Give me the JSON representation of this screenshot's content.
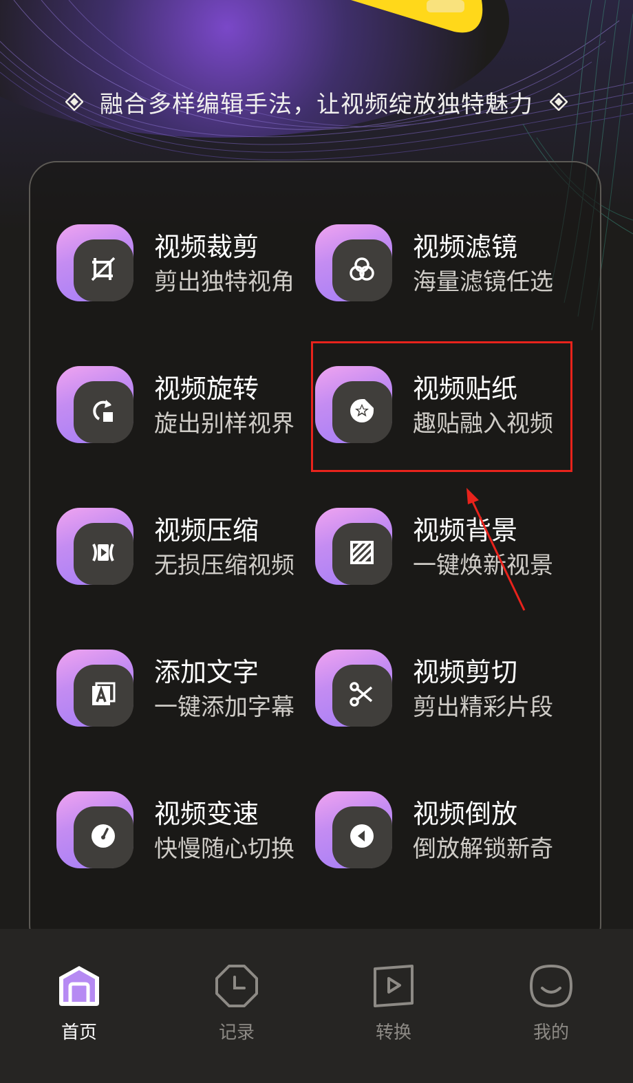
{
  "colors": {
    "background": "#1d1c1a",
    "accent_purple": "#a27df6",
    "accent_pink": "#f0a4f0",
    "banner_yellow": "#ffd81a",
    "highlight_red": "#e8231c",
    "tabbar": "#262523"
  },
  "tagline": {
    "text": "融合多样编辑手法，让视频绽放独特魅力",
    "left_icon": "diamond-icon",
    "right_icon": "diamond-icon"
  },
  "tools": [
    {
      "title": "视频裁剪",
      "subtitle": "剪出独特视角",
      "icon": "crop-icon"
    },
    {
      "title": "视频滤镜",
      "subtitle": "海量滤镜任选",
      "icon": "filter-icon"
    },
    {
      "title": "视频旋转",
      "subtitle": "旋出别样视界",
      "icon": "rotate-icon"
    },
    {
      "title": "视频贴纸",
      "subtitle": "趣贴融入视频",
      "icon": "sticker-icon"
    },
    {
      "title": "视频压缩",
      "subtitle": "无损压缩视频",
      "icon": "compress-icon"
    },
    {
      "title": "视频背景",
      "subtitle": "一键焕新视景",
      "icon": "background-icon"
    },
    {
      "title": "添加文字",
      "subtitle": "一键添加字幕",
      "icon": "text-icon"
    },
    {
      "title": "视频剪切",
      "subtitle": "剪出精彩片段",
      "icon": "scissors-icon"
    },
    {
      "title": "视频变速",
      "subtitle": "快慢随心切换",
      "icon": "speed-icon"
    },
    {
      "title": "视频倒放",
      "subtitle": "倒放解锁新奇",
      "icon": "reverse-icon"
    }
  ],
  "tabbar": {
    "tabs": [
      {
        "label": "首页",
        "icon": "home-icon",
        "active": true
      },
      {
        "label": "记录",
        "icon": "clock-icon",
        "active": false
      },
      {
        "label": "转换",
        "icon": "play-icon",
        "active": false
      },
      {
        "label": "我的",
        "icon": "smile-icon",
        "active": false
      }
    ]
  }
}
